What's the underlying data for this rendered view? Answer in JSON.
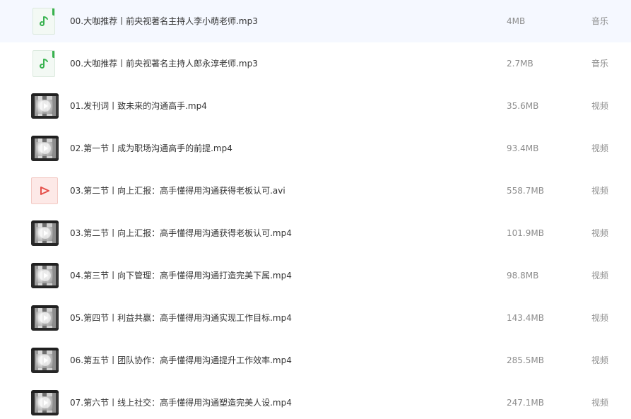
{
  "colors": {
    "audio_icon": "#38b24f",
    "video_file_icon": "#e5504a"
  },
  "files": [
    {
      "name": "00.大咖推荐丨前央视著名主持人李小萌老师.mp3",
      "size": "4MB",
      "type": "音乐",
      "icon": "music-note-icon"
    },
    {
      "name": "00.大咖推荐丨前央视著名主持人郎永淳老师.mp3",
      "size": "2.7MB",
      "type": "音乐",
      "icon": "music-note-icon"
    },
    {
      "name": "01.发刊词丨致未来的沟通高手.mp4",
      "size": "35.6MB",
      "type": "视频",
      "icon": "video-thumbnail"
    },
    {
      "name": "02.第一节丨成为职场沟通高手的前提.mp4",
      "size": "93.4MB",
      "type": "视频",
      "icon": "video-thumbnail"
    },
    {
      "name": "03.第二节丨向上汇报：高手懂得用沟通获得老板认可.avi",
      "size": "558.7MB",
      "type": "视频",
      "icon": "play-triangle-icon"
    },
    {
      "name": "03.第二节丨向上汇报：高手懂得用沟通获得老板认可.mp4",
      "size": "101.9MB",
      "type": "视频",
      "icon": "video-thumbnail"
    },
    {
      "name": "04.第三节丨向下管理：高手懂得用沟通打造完美下属.mp4",
      "size": "98.8MB",
      "type": "视频",
      "icon": "video-thumbnail"
    },
    {
      "name": "05.第四节丨利益共赢：高手懂得用沟通实现工作目标.mp4",
      "size": "143.4MB",
      "type": "视频",
      "icon": "video-thumbnail"
    },
    {
      "name": "06.第五节丨团队协作：高手懂得用沟通提升工作效率.mp4",
      "size": "285.5MB",
      "type": "视频",
      "icon": "video-thumbnail"
    },
    {
      "name": "07.第六节丨线上社交：高手懂得用沟通塑造完美人设.mp4",
      "size": "247.1MB",
      "type": "视频",
      "icon": "video-thumbnail"
    }
  ]
}
